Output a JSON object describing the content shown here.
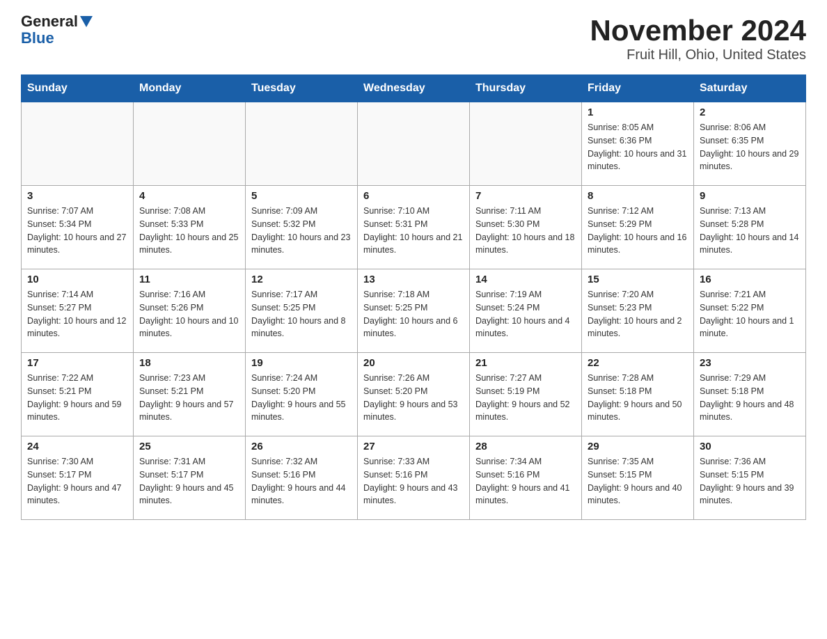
{
  "logo": {
    "line1": "General",
    "line2": "Blue"
  },
  "title": "November 2024",
  "subtitle": "Fruit Hill, Ohio, United States",
  "days_of_week": [
    "Sunday",
    "Monday",
    "Tuesday",
    "Wednesday",
    "Thursday",
    "Friday",
    "Saturday"
  ],
  "weeks": [
    [
      {
        "day": "",
        "info": ""
      },
      {
        "day": "",
        "info": ""
      },
      {
        "day": "",
        "info": ""
      },
      {
        "day": "",
        "info": ""
      },
      {
        "day": "",
        "info": ""
      },
      {
        "day": "1",
        "info": "Sunrise: 8:05 AM\nSunset: 6:36 PM\nDaylight: 10 hours and 31 minutes."
      },
      {
        "day": "2",
        "info": "Sunrise: 8:06 AM\nSunset: 6:35 PM\nDaylight: 10 hours and 29 minutes."
      }
    ],
    [
      {
        "day": "3",
        "info": "Sunrise: 7:07 AM\nSunset: 5:34 PM\nDaylight: 10 hours and 27 minutes."
      },
      {
        "day": "4",
        "info": "Sunrise: 7:08 AM\nSunset: 5:33 PM\nDaylight: 10 hours and 25 minutes."
      },
      {
        "day": "5",
        "info": "Sunrise: 7:09 AM\nSunset: 5:32 PM\nDaylight: 10 hours and 23 minutes."
      },
      {
        "day": "6",
        "info": "Sunrise: 7:10 AM\nSunset: 5:31 PM\nDaylight: 10 hours and 21 minutes."
      },
      {
        "day": "7",
        "info": "Sunrise: 7:11 AM\nSunset: 5:30 PM\nDaylight: 10 hours and 18 minutes."
      },
      {
        "day": "8",
        "info": "Sunrise: 7:12 AM\nSunset: 5:29 PM\nDaylight: 10 hours and 16 minutes."
      },
      {
        "day": "9",
        "info": "Sunrise: 7:13 AM\nSunset: 5:28 PM\nDaylight: 10 hours and 14 minutes."
      }
    ],
    [
      {
        "day": "10",
        "info": "Sunrise: 7:14 AM\nSunset: 5:27 PM\nDaylight: 10 hours and 12 minutes."
      },
      {
        "day": "11",
        "info": "Sunrise: 7:16 AM\nSunset: 5:26 PM\nDaylight: 10 hours and 10 minutes."
      },
      {
        "day": "12",
        "info": "Sunrise: 7:17 AM\nSunset: 5:25 PM\nDaylight: 10 hours and 8 minutes."
      },
      {
        "day": "13",
        "info": "Sunrise: 7:18 AM\nSunset: 5:25 PM\nDaylight: 10 hours and 6 minutes."
      },
      {
        "day": "14",
        "info": "Sunrise: 7:19 AM\nSunset: 5:24 PM\nDaylight: 10 hours and 4 minutes."
      },
      {
        "day": "15",
        "info": "Sunrise: 7:20 AM\nSunset: 5:23 PM\nDaylight: 10 hours and 2 minutes."
      },
      {
        "day": "16",
        "info": "Sunrise: 7:21 AM\nSunset: 5:22 PM\nDaylight: 10 hours and 1 minute."
      }
    ],
    [
      {
        "day": "17",
        "info": "Sunrise: 7:22 AM\nSunset: 5:21 PM\nDaylight: 9 hours and 59 minutes."
      },
      {
        "day": "18",
        "info": "Sunrise: 7:23 AM\nSunset: 5:21 PM\nDaylight: 9 hours and 57 minutes."
      },
      {
        "day": "19",
        "info": "Sunrise: 7:24 AM\nSunset: 5:20 PM\nDaylight: 9 hours and 55 minutes."
      },
      {
        "day": "20",
        "info": "Sunrise: 7:26 AM\nSunset: 5:20 PM\nDaylight: 9 hours and 53 minutes."
      },
      {
        "day": "21",
        "info": "Sunrise: 7:27 AM\nSunset: 5:19 PM\nDaylight: 9 hours and 52 minutes."
      },
      {
        "day": "22",
        "info": "Sunrise: 7:28 AM\nSunset: 5:18 PM\nDaylight: 9 hours and 50 minutes."
      },
      {
        "day": "23",
        "info": "Sunrise: 7:29 AM\nSunset: 5:18 PM\nDaylight: 9 hours and 48 minutes."
      }
    ],
    [
      {
        "day": "24",
        "info": "Sunrise: 7:30 AM\nSunset: 5:17 PM\nDaylight: 9 hours and 47 minutes."
      },
      {
        "day": "25",
        "info": "Sunrise: 7:31 AM\nSunset: 5:17 PM\nDaylight: 9 hours and 45 minutes."
      },
      {
        "day": "26",
        "info": "Sunrise: 7:32 AM\nSunset: 5:16 PM\nDaylight: 9 hours and 44 minutes."
      },
      {
        "day": "27",
        "info": "Sunrise: 7:33 AM\nSunset: 5:16 PM\nDaylight: 9 hours and 43 minutes."
      },
      {
        "day": "28",
        "info": "Sunrise: 7:34 AM\nSunset: 5:16 PM\nDaylight: 9 hours and 41 minutes."
      },
      {
        "day": "29",
        "info": "Sunrise: 7:35 AM\nSunset: 5:15 PM\nDaylight: 9 hours and 40 minutes."
      },
      {
        "day": "30",
        "info": "Sunrise: 7:36 AM\nSunset: 5:15 PM\nDaylight: 9 hours and 39 minutes."
      }
    ]
  ]
}
